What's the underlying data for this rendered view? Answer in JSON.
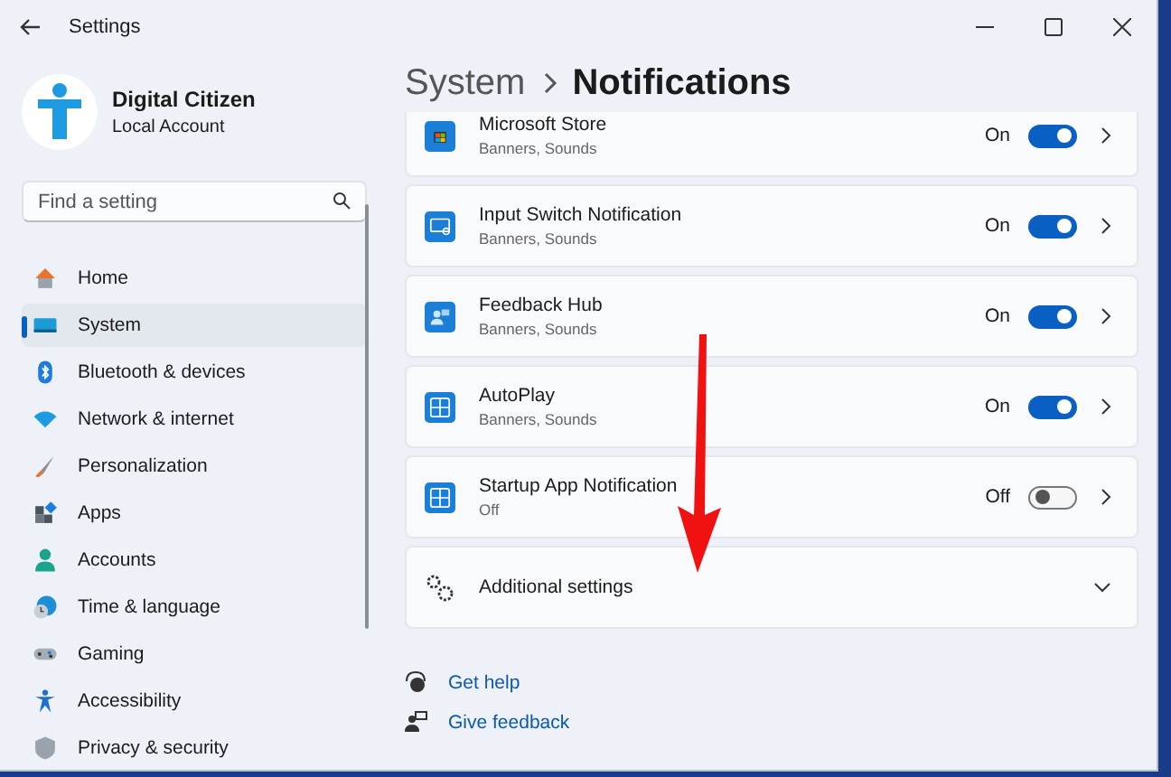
{
  "window": {
    "title": "Settings"
  },
  "profile": {
    "name": "Digital Citizen",
    "account": "Local Account"
  },
  "search": {
    "placeholder": "Find a setting"
  },
  "nav": [
    {
      "label": "Home",
      "selected": false
    },
    {
      "label": "System",
      "selected": true
    },
    {
      "label": "Bluetooth & devices",
      "selected": false
    },
    {
      "label": "Network & internet",
      "selected": false
    },
    {
      "label": "Personalization",
      "selected": false
    },
    {
      "label": "Apps",
      "selected": false
    },
    {
      "label": "Accounts",
      "selected": false
    },
    {
      "label": "Time & language",
      "selected": false
    },
    {
      "label": "Gaming",
      "selected": false
    },
    {
      "label": "Accessibility",
      "selected": false
    },
    {
      "label": "Privacy & security",
      "selected": false
    }
  ],
  "breadcrumb": {
    "parent": "System",
    "current": "Notifications"
  },
  "apps": [
    {
      "name": "Microsoft Store",
      "summary": "Banners, Sounds",
      "state": "On",
      "on": true
    },
    {
      "name": "Input Switch Notification",
      "summary": "Banners, Sounds",
      "state": "On",
      "on": true
    },
    {
      "name": "Feedback Hub",
      "summary": "Banners, Sounds",
      "state": "On",
      "on": true
    },
    {
      "name": "AutoPlay",
      "summary": "Banners, Sounds",
      "state": "On",
      "on": true
    },
    {
      "name": "Startup App Notification",
      "summary": "Off",
      "state": "Off",
      "on": false
    }
  ],
  "additional": {
    "label": "Additional settings",
    "expanded": false
  },
  "links": [
    "Get help",
    "Give feedback"
  ]
}
